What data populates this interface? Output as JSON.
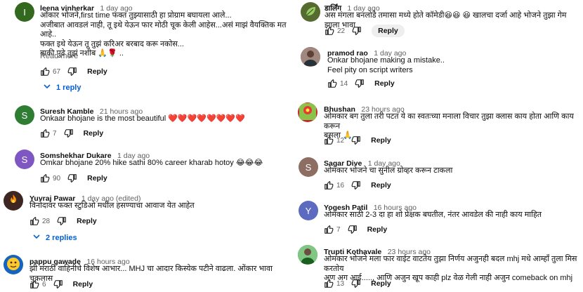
{
  "ui": {
    "reply_label": "Reply"
  },
  "left_comments": [
    {
      "author": "leena vinherkar",
      "time": "1 day ago",
      "avatar_letter": "I",
      "avatar_color": "#33691e",
      "text": "ओंकार भोजने,first time फक्त  तुझ्यासाठी हा प्रोग्राम बघायला आले...\nअजीबात आवडलं  नाही, तू इथे येऊन फार मोठी चूक केली आहेस...असं माझं वैयक्तिक मत आहे..\nफक्त इथे येऊन तू तुझं करिअर बरबाद  करू नकोस...\nबाकी पुढे तुझं नशीब 🙏🌹 ..",
      "read_more": "Read more",
      "likes": "67",
      "replies_link": "1 reply"
    },
    {
      "author": "Suresh Kamble",
      "time": "21 hours ago",
      "avatar_letter": "S",
      "avatar_color": "#2e7d32",
      "text": "Onkaar bhojane is the most beautiful ❤️❤️❤️❤️❤️❤️❤️❤️",
      "likes": "7"
    },
    {
      "author": "Somshekhar Dukare",
      "time": "1 day ago",
      "avatar_letter": "S",
      "avatar_color": "#7e57c2",
      "text": "Omkar bhojane 20% hike sathi 80% career kharab hotoy 😂😂😂",
      "likes": "90"
    },
    {
      "author": "Yuvraj Pawar",
      "time": "1 day ago (edited)",
      "avatar_letter": "",
      "avatar_color": "#3e2723",
      "text": "विनोदावर फक्त स्टुडिओ मधील हसण्याचा आवाज येत आहेत",
      "likes": "28",
      "replies_link": "2 replies"
    },
    {
      "author": "pappu gawade",
      "time": "16 hours ago",
      "avatar_letter": "",
      "avatar_color": "#1565c0",
      "text": "झी मराठी वाहिनीचे विशेष आभार... MHJ चा आदार किस्येक पटीने वाढला. ओंकार भावा चुकलास",
      "likes": "6"
    }
  ],
  "right_comments": [
    {
      "author": "डार्लिंग",
      "time": "1 day ago",
      "avatar_letter": "",
      "avatar_color": "#556b2f",
      "text": "अस मंगला बनलोडे तमासा मध्ये होते कॉमेडी😆😆 😆 खालचा दर्जा आहे  भोजने तुझा गेम झाला भावा",
      "likes": "22",
      "reply_pill": true
    },
    {
      "author": "pramod rao",
      "time": "1 day ago",
      "avatar_letter": "",
      "avatar_color": "#795548",
      "text": "Onkar bhojane making a mistake..\nFeel pity on script writers",
      "likes": "14"
    },
    {
      "author": "Bhushan",
      "time": "23 hours ago",
      "avatar_letter": "",
      "avatar_color": "#c62828",
      "text": "ओमकार बग तुला तरी पटत ये का स्वतःच्या मनाला विचार तुझा क्लास काय होता आणि काय करून\nबसला 🙏",
      "likes": "12"
    },
    {
      "author": "Sagar Dive",
      "time": "1 day ago",
      "avatar_letter": "S",
      "avatar_color": "#8d6e63",
      "text": "ओमकार भोजने चा सुनील ग्रोव्हर करून टाकला",
      "likes": "16"
    },
    {
      "author": "Yogesh Patil",
      "time": "16 hours ago",
      "avatar_letter": "Y",
      "avatar_color": "#5c6bc0",
      "text": "ओमकार साठी 2-3 दा हा शो प्रेक्षक बघतील, नंतर आवडेल की नाही काय माहित",
      "likes": "7"
    },
    {
      "author": "Trupti Kothavale",
      "time": "23 hours ago",
      "avatar_letter": "",
      "avatar_color": "#2e7d32",
      "text": "ओमकार भोजने मला फार वाईट वाटतेय तुझा निर्णय अजुनही बदल mhj मधे आम्हाँ तुला मिस करतोय\nअण अग आई....., आणि अजुन खूप काही plz वेळ गेली नाही अजुन comeback on mhj",
      "likes": "13"
    }
  ]
}
